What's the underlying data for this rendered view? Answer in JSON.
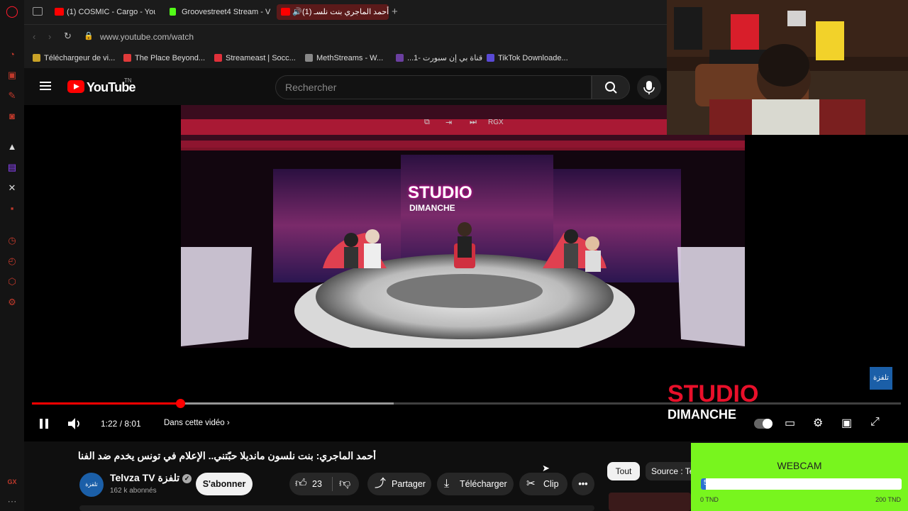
{
  "tabs": [
    {
      "label": "(1) COSMIC - Cargo - You",
      "favicon_color": "#ff0000"
    },
    {
      "label": "Groovestreet4 Stream - V",
      "favicon_color": "#53fc18"
    },
    {
      "label": "(1) أحمد الماجري بنت نلسـ",
      "favicon_color": "#ff0000",
      "active": true
    }
  ],
  "address": {
    "url": "www.youtube.com/watch"
  },
  "bookmarks": [
    {
      "label": "Téléchargeur de vi...",
      "color": "#c9a227"
    },
    {
      "label": "The Place Beyond...",
      "color": "#e03a3a"
    },
    {
      "label": "Streameast | Socc...",
      "color": "#e0303a"
    },
    {
      "label": "MethStreams - W...",
      "color": "#888888"
    },
    {
      "label": "...1- قناة بي إن سبورت",
      "color": "#6b3fa0"
    },
    {
      "label": "TikTok Downloade...",
      "color": "#5a4ad6"
    }
  ],
  "youtube": {
    "logo_text": "YouTube",
    "region": "TN",
    "search_placeholder": "Rechercher"
  },
  "player": {
    "time": "1:22 / 8:01",
    "chapter_label": "Dans cette vidéo",
    "progress": 0.171,
    "overlay_tag": "RGX",
    "studio_brand_1": "STUDIO",
    "studio_brand_2": "DIMANCHE",
    "channel_watermark": "تلفزة"
  },
  "video": {
    "title": "أحمد الماجري: بنت نلسون مانديلا حبّتني.. الإعلام في تونس يخدم ضد الفنان..",
    "channel_name": "Telvza TV تلفزة",
    "subscribers": "162 k abonnés",
    "subscribe_label": "S'abonner",
    "likes": "23",
    "share_label": "Partager",
    "download_label": "Télécharger",
    "clip_label": "Clip"
  },
  "filters": {
    "all_label": "Tout",
    "source_label": "Source : Te"
  },
  "sidebar_bottom": {
    "label": "GX"
  },
  "donation": {
    "title": "WEBCAM",
    "current": "5",
    "min_label": "0 TND",
    "max_label": "200 TND",
    "progress": 0.025
  },
  "colors": {
    "accent": "#ff0000",
    "donation_bg": "#78f51e",
    "background": "#0f0f0f"
  }
}
